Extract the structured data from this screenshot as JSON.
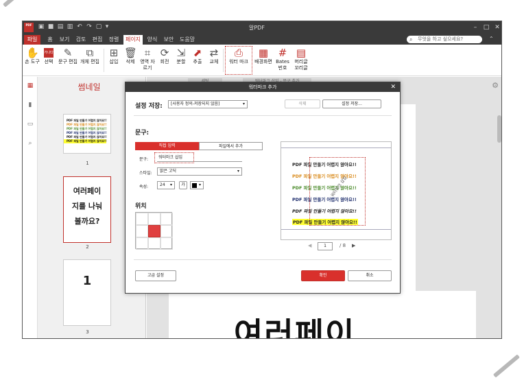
{
  "app": {
    "title": "알PDF",
    "logo_text": "PDF",
    "search_placeholder": "무엇을 하고 싶으세요?"
  },
  "menu": {
    "tabs": [
      "파일",
      "홈",
      "보기",
      "검토",
      "편집",
      "정렬",
      "페이지",
      "양식",
      "보안",
      "도움말"
    ],
    "active": "페이지"
  },
  "ribbon": {
    "items": [
      {
        "label": "손 도구",
        "icon": "hand-icon"
      },
      {
        "label": "선택",
        "icon": "select-icon"
      },
      {
        "label": "문구 편집",
        "icon": "edit-text-icon"
      },
      {
        "label": "개체 편집",
        "icon": "edit-object-icon"
      },
      {
        "label": "삽입",
        "icon": "insert-icon"
      },
      {
        "label": "삭제",
        "icon": "delete-icon"
      },
      {
        "label": "영역 자르기",
        "icon": "crop-icon"
      },
      {
        "label": "회전",
        "icon": "rotate-icon"
      },
      {
        "label": "분할",
        "icon": "split-icon"
      },
      {
        "label": "추출",
        "icon": "extract-icon"
      },
      {
        "label": "교체",
        "icon": "replace-icon"
      },
      {
        "label": "워터 마크",
        "icon": "watermark-icon"
      },
      {
        "label": "배경화면",
        "icon": "background-icon"
      },
      {
        "label": "Bates 번호",
        "icon": "bates-icon"
      },
      {
        "label": "머리글 꼬리글",
        "icon": "header-footer-icon"
      }
    ],
    "selected_badge": "가나다"
  },
  "sidebar": {
    "thumbnails_title": "썸네일",
    "pages": [
      {
        "num": "1",
        "lines": [
          "PDF 파일 만들기 어렵지 않아요!!",
          "PDF 파일 만들기 어렵지 않아요!!",
          "PDF 파일 만들기 어렵지 않아요!!",
          "PDF 파일 만들기 어렵지 않아요!!",
          "PDF 파일 만들기 어렵지 않아요!!",
          "PDF 파일 만들기 어렵지 않아요!!"
        ]
      },
      {
        "num": "2",
        "lines": [
          "여러페이",
          "지를 나눠",
          "볼까요?"
        ]
      },
      {
        "num": "3",
        "lines": [
          "1"
        ]
      }
    ]
  },
  "main": {
    "big_text": "여러페이",
    "tab_fragments": [
      "세팅",
      "워터마크 삽입 - 문구 추가"
    ]
  },
  "dialog": {
    "title": "워터마크 추가",
    "preset_label": "설정 저장:",
    "preset_value": "[사용자 정의-저장되지 않음]",
    "delete_btn": "삭제",
    "save_btn": "설정 저장...",
    "text_section": "문구:",
    "seg_direct": "직접 입력",
    "seg_file": "파일에서 추가",
    "text_label": "문구:",
    "text_value": "워터마크 삽입",
    "style_label": "스타일:",
    "style_value": "맑은 고딕",
    "attr_label": "속성:",
    "size_value": "24",
    "bold_glyph": "가",
    "position_label": "위치",
    "advanced_btn": "고급 설정",
    "ok_btn": "확인",
    "cancel_btn": "취소",
    "page_current": "1",
    "page_total": "/ 8",
    "preview_lines": [
      {
        "text": "PDF 파일 만들기 어렵지 않아요!!",
        "color": "#111111"
      },
      {
        "text": "PDF 파일 만들기 어렵지 않아요!!",
        "color": "#d98a1a"
      },
      {
        "text": "PDF 파일 만들기 어렵지 않아요!!",
        "color": "#4a8a2a"
      },
      {
        "text": "PDF 파일 만들기 어렵지 않아요!!",
        "color": "#1a2a6a"
      },
      {
        "text": "PDF 파일 만들기 어렵지 않아요!!",
        "color": "#111111"
      },
      {
        "text": "PDF 파일 만들기 어렵지 않아요!!",
        "color": "#111111",
        "highlight": "#ffff33"
      }
    ],
    "watermark_preview": "워터마크 삽입"
  },
  "colors": {
    "accent": "#c0302b",
    "dark": "#3a3a3a"
  }
}
